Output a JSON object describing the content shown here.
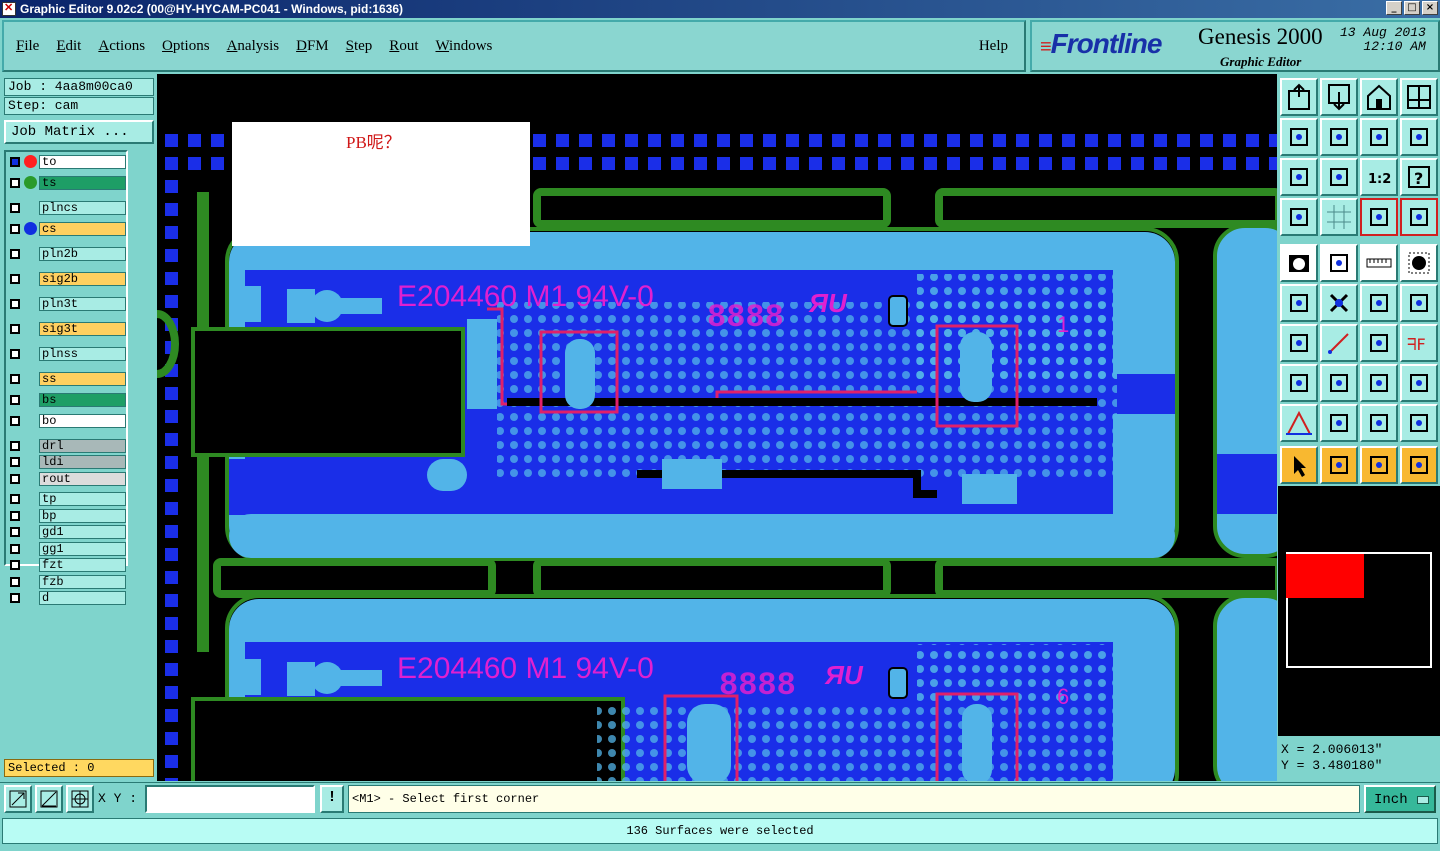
{
  "window": {
    "title": "Graphic Editor 9.02c2 (00@HY-HYCAM-PC041 - Windows, pid:1636)"
  },
  "menu": {
    "items": [
      "File",
      "Edit",
      "Actions",
      "Options",
      "Analysis",
      "DFM",
      "Step",
      "Rout",
      "Windows"
    ],
    "help": "Help"
  },
  "logo": {
    "brand": "Frontline",
    "product": "Genesis 2000",
    "subtitle": "Graphic Editor",
    "date": "13 Aug 2013",
    "time": "12:10 AM"
  },
  "job": {
    "job_line": "Job : 4aa8m00ca0",
    "step_line": "Step: cam",
    "matrix_button": "Job Matrix ..."
  },
  "layers": [
    {
      "name": "to",
      "color": "#ffffff",
      "dot": "#ff2020",
      "checked": true
    },
    {
      "name": "ts",
      "color": "#1e9e66",
      "dot": "#2a9a2a",
      "checked": false
    },
    {
      "name": "plncs",
      "color": "#a8ece4",
      "dot": "",
      "checked": false
    },
    {
      "name": "cs",
      "color": "#ffd060",
      "dot": "#1030e0",
      "checked": false
    },
    {
      "name": "pln2b",
      "color": "#a8ece4",
      "dot": "",
      "checked": false
    },
    {
      "name": "sig2b",
      "color": "#ffd060",
      "dot": "",
      "checked": false
    },
    {
      "name": "pln3t",
      "color": "#a8ece4",
      "dot": "",
      "checked": false
    },
    {
      "name": "sig3t",
      "color": "#ffd060",
      "dot": "",
      "checked": false
    },
    {
      "name": "plnss",
      "color": "#a8ece4",
      "dot": "",
      "checked": false
    },
    {
      "name": "ss",
      "color": "#ffd060",
      "dot": "",
      "checked": false
    },
    {
      "name": "bs",
      "color": "#1e9e66",
      "dot": "",
      "checked": false
    },
    {
      "name": "bo",
      "color": "#ffffff",
      "dot": "",
      "checked": false
    },
    {
      "name": "drl",
      "color": "#a8b8b8",
      "dot": "",
      "checked": false
    },
    {
      "name": "ldi",
      "color": "#a8b8b8",
      "dot": "",
      "checked": false
    },
    {
      "name": "rout",
      "color": "#dcdcdc",
      "dot": "",
      "checked": false
    },
    {
      "name": "tp",
      "color": "#a8ece4",
      "dot": "",
      "checked": false
    },
    {
      "name": "bp",
      "color": "#a8ece4",
      "dot": "",
      "checked": false
    },
    {
      "name": "gd1",
      "color": "#a8ece4",
      "dot": "",
      "checked": false
    },
    {
      "name": "gg1",
      "color": "#a8ece4",
      "dot": "",
      "checked": false
    },
    {
      "name": "fzt",
      "color": "#a8ece4",
      "dot": "",
      "checked": false
    },
    {
      "name": "fzb",
      "color": "#a8ece4",
      "dot": "",
      "checked": false
    },
    {
      "name": "d",
      "color": "#a8ece4",
      "dot": "",
      "checked": false
    }
  ],
  "selected_label": "Selected : 0",
  "canvas": {
    "note": "PB呢？",
    "marking_top": "E204460 M1 94V-0",
    "marking_bottom": "E204460 M1 94V-0",
    "date_code": "8888",
    "number_top": "1",
    "number_bottom": "6",
    "colors": {
      "surface": "#1a2ee8",
      "pad": "#52b4e8",
      "outline": "#2e8a22",
      "text": "#e020d0",
      "trace_edge": "#e0206a"
    }
  },
  "coords": {
    "x": "X = 2.006013\"",
    "y": "Y = 3.480180\""
  },
  "cmd": {
    "xy_label": "X Y :",
    "xy_value": "",
    "bang": "!",
    "prompt": "<M1> - Select first corner",
    "units": "Inch"
  },
  "status": "136 Surfaces were selected",
  "toolbar_icons": [
    "zoom-window-icon",
    "zoom-out-icon",
    "home-icon",
    "split-view-icon",
    "pan-left-icon",
    "pan-right-icon",
    "redraw-icon",
    "snap-icon",
    "fit-all-icon",
    "fit-profile-icon",
    "scale-1-2-icon",
    "help-icon",
    "measure-tool-icon",
    "grid-icon",
    "layer-toggle-icon",
    "layer-toggle-2-icon",
    "camera-icon",
    "select-area-icon",
    "ruler-icon",
    "stop-icon",
    "connect-icon",
    "cross-icon",
    "move-point-icon",
    "move-point-2-icon",
    "angle-icon",
    "line-icon",
    "rotate-icon",
    "mirror-icon",
    "pad-icon",
    "line-break-icon",
    "resize-icon",
    "shapes-icon",
    "triangle-icon",
    "triangle-alt-icon",
    "arch-icon",
    "arch-alt-icon",
    "pointer-icon",
    "pointer-box-icon",
    "pointer-frame-icon",
    "route-icon"
  ]
}
